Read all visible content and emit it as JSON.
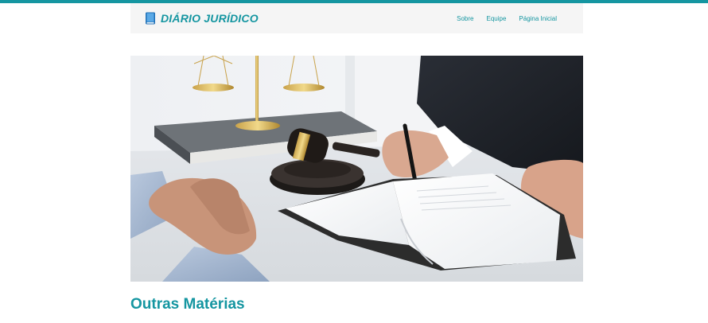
{
  "brand": {
    "name": "DIÁRIO JURÍDICO",
    "icon": "book-icon"
  },
  "nav": {
    "items": [
      {
        "label": "Sobre"
      },
      {
        "label": "Equipe"
      },
      {
        "label": "Página Inicial"
      }
    ]
  },
  "hero": {
    "image": "legal-meeting-photo",
    "description_icon": "gavel-scales-book-photo"
  },
  "sections": {
    "other_articles_title": "Outras Matérias"
  },
  "colors": {
    "accent": "#1596a1",
    "navbar_bg": "#f5f5f5",
    "page_bg": "#ffffff"
  }
}
